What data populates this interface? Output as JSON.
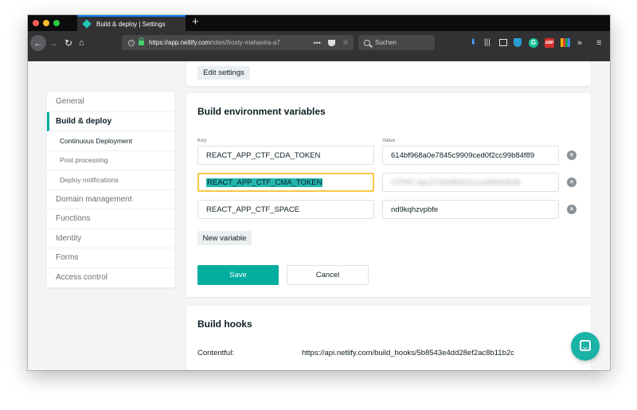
{
  "browser": {
    "tab_title": "Build & deploy | Settings",
    "new_tab": "+",
    "url_host": "https://app.netlify.com",
    "url_path": "/sites/frosty-mahavira-a7",
    "url_overflow": "•••",
    "search_placeholder": "Suchen",
    "icons": {
      "back": "←",
      "forward": "→",
      "reload": "↻",
      "home": "⌂",
      "bookmark": "☆",
      "download": "⬇",
      "library": "|||",
      "grammarly": "G",
      "adblock": "ABP",
      "overflow": "»",
      "menu": "≡"
    }
  },
  "sidebar": {
    "items": [
      {
        "label": "General"
      },
      {
        "label": "Build & deploy"
      },
      {
        "label": "Continuous Deployment"
      },
      {
        "label": "Post processing"
      },
      {
        "label": "Deploy notifications"
      },
      {
        "label": "Domain management"
      },
      {
        "label": "Functions"
      },
      {
        "label": "Identity"
      },
      {
        "label": "Forms"
      },
      {
        "label": "Access control"
      }
    ]
  },
  "top_card": {
    "edit_settings_label": "Edit settings"
  },
  "env": {
    "title": "Build environment variables",
    "key_label": "Key",
    "value_label": "Value",
    "rows": [
      {
        "key": "REACT_APP_CTF_CDA_TOKEN",
        "value": "614bf968a0e7845c9909ced0f2cc99b84f89"
      },
      {
        "key": "REACT_APP_CTF_CMA_TOKEN",
        "value": "CFPAT-3ac1f76b0f0d10c1ca980e6b2b"
      },
      {
        "key": "REACT_APP_CTF_SPACE",
        "value": "nd9kqhzvpbfe"
      }
    ],
    "remove_glyph": "×",
    "new_variable_label": "New variable",
    "save_label": "Save",
    "cancel_label": "Cancel"
  },
  "hooks": {
    "title": "Build hooks",
    "label": "Contentful:",
    "url": "https://api.netlify.com/build_hooks/5b8543e4dd28ef2ac8b11b2c"
  },
  "colors": {
    "accent": "#00ad9f",
    "focus": "#f7c744",
    "selection": "#24b6ae"
  }
}
